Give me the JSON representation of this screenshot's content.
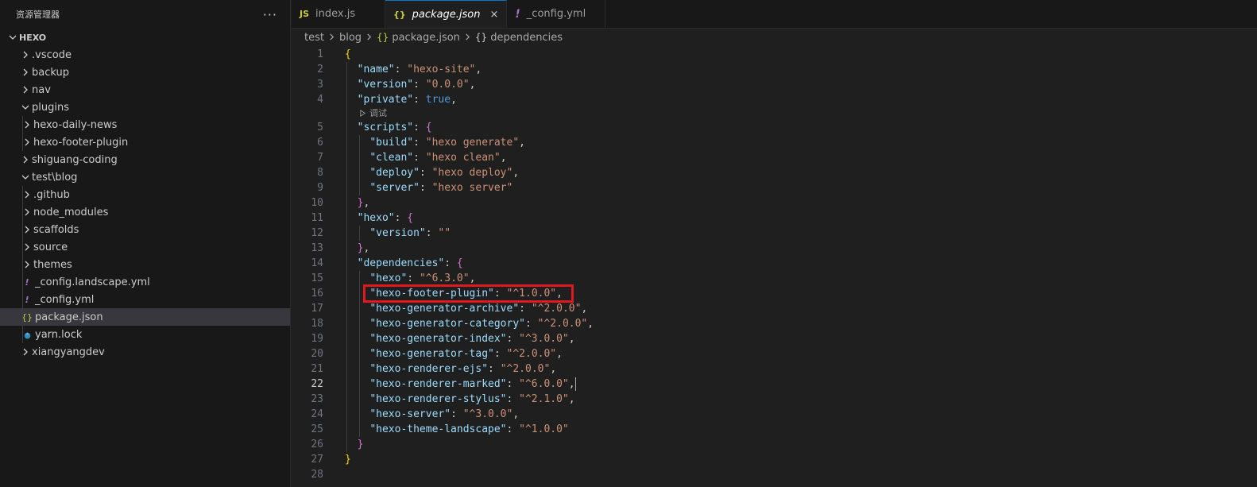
{
  "sidebar": {
    "title": "资源管理器",
    "more": "···",
    "root": "HEXO",
    "items": [
      {
        "label": ".vscode",
        "depth": 1,
        "type": "folder",
        "open": false
      },
      {
        "label": "backup",
        "depth": 1,
        "type": "folder",
        "open": false
      },
      {
        "label": "nav",
        "depth": 1,
        "type": "folder",
        "open": false
      },
      {
        "label": "plugins",
        "depth": 1,
        "type": "folder",
        "open": true
      },
      {
        "label": "hexo-daily-news",
        "depth": 2,
        "type": "folder",
        "open": false
      },
      {
        "label": "hexo-footer-plugin",
        "depth": 2,
        "type": "folder",
        "open": false
      },
      {
        "label": "shiguang-coding",
        "depth": 1,
        "type": "folder",
        "open": false
      },
      {
        "label": "test\\blog",
        "depth": 1,
        "type": "folder",
        "open": true
      },
      {
        "label": ".github",
        "depth": 2,
        "type": "folder",
        "open": false
      },
      {
        "label": "node_modules",
        "depth": 2,
        "type": "folder",
        "open": false
      },
      {
        "label": "scaffolds",
        "depth": 2,
        "type": "folder",
        "open": false
      },
      {
        "label": "source",
        "depth": 2,
        "type": "folder",
        "open": false
      },
      {
        "label": "themes",
        "depth": 2,
        "type": "folder",
        "open": false
      },
      {
        "label": "_config.landscape.yml",
        "depth": 2,
        "type": "yml"
      },
      {
        "label": "_config.yml",
        "depth": 2,
        "type": "yml"
      },
      {
        "label": "package.json",
        "depth": 2,
        "type": "json",
        "selected": true
      },
      {
        "label": "yarn.lock",
        "depth": 2,
        "type": "yarn"
      },
      {
        "label": "xiangyangdev",
        "depth": 1,
        "type": "folder",
        "open": false
      }
    ]
  },
  "tabs": [
    {
      "label": "index.js",
      "icon": "JS",
      "icon_color": "#cbcb41",
      "active": false
    },
    {
      "label": "package.json",
      "icon": "{}",
      "icon_color": "#cbcb41",
      "active": true,
      "close": "×"
    },
    {
      "label": "_config.yml",
      "icon": "!",
      "icon_color": "#a074c4",
      "active": false
    }
  ],
  "breadcrumbs": [
    "test",
    "blog",
    "package.json",
    "dependencies"
  ],
  "breadcrumb_icons": {
    "package.json": "{}",
    "dependencies": "{}"
  },
  "codelens_label": "调试",
  "current_line": 22,
  "highlight_line": 16,
  "code_lines": [
    [
      [
        "{",
        "b1"
      ]
    ],
    [
      [
        "  ",
        "p"
      ],
      [
        "\"name\"",
        "k"
      ],
      [
        ": ",
        "p"
      ],
      [
        "\"hexo-site\"",
        "s"
      ],
      [
        ",",
        "p"
      ]
    ],
    [
      [
        "  ",
        "p"
      ],
      [
        "\"version\"",
        "k"
      ],
      [
        ": ",
        "p"
      ],
      [
        "\"0.0.0\"",
        "s"
      ],
      [
        ",",
        "p"
      ]
    ],
    [
      [
        "  ",
        "p"
      ],
      [
        "\"private\"",
        "k"
      ],
      [
        ": ",
        "p"
      ],
      [
        "true",
        "kw"
      ],
      [
        ",",
        "p"
      ]
    ],
    [
      [
        "  ",
        "p"
      ],
      [
        "\"scripts\"",
        "k"
      ],
      [
        ": ",
        "p"
      ],
      [
        "{",
        "b2"
      ]
    ],
    [
      [
        "    ",
        "p"
      ],
      [
        "\"build\"",
        "k"
      ],
      [
        ": ",
        "p"
      ],
      [
        "\"hexo generate\"",
        "s"
      ],
      [
        ",",
        "p"
      ]
    ],
    [
      [
        "    ",
        "p"
      ],
      [
        "\"clean\"",
        "k"
      ],
      [
        ": ",
        "p"
      ],
      [
        "\"hexo clean\"",
        "s"
      ],
      [
        ",",
        "p"
      ]
    ],
    [
      [
        "    ",
        "p"
      ],
      [
        "\"deploy\"",
        "k"
      ],
      [
        ": ",
        "p"
      ],
      [
        "\"hexo deploy\"",
        "s"
      ],
      [
        ",",
        "p"
      ]
    ],
    [
      [
        "    ",
        "p"
      ],
      [
        "\"server\"",
        "k"
      ],
      [
        ": ",
        "p"
      ],
      [
        "\"hexo server\"",
        "s"
      ]
    ],
    [
      [
        "  ",
        "p"
      ],
      [
        "}",
        "b2"
      ],
      [
        ",",
        "p"
      ]
    ],
    [
      [
        "  ",
        "p"
      ],
      [
        "\"hexo\"",
        "k"
      ],
      [
        ": ",
        "p"
      ],
      [
        "{",
        "b2"
      ]
    ],
    [
      [
        "    ",
        "p"
      ],
      [
        "\"version\"",
        "k"
      ],
      [
        ": ",
        "p"
      ],
      [
        "\"\"",
        "s"
      ]
    ],
    [
      [
        "  ",
        "p"
      ],
      [
        "}",
        "b2"
      ],
      [
        ",",
        "p"
      ]
    ],
    [
      [
        "  ",
        "p"
      ],
      [
        "\"dependencies\"",
        "k"
      ],
      [
        ": ",
        "p"
      ],
      [
        "{",
        "b2"
      ]
    ],
    [
      [
        "    ",
        "p"
      ],
      [
        "\"hexo\"",
        "k"
      ],
      [
        ": ",
        "p"
      ],
      [
        "\"^6.3.0\"",
        "s"
      ],
      [
        ",",
        "p"
      ]
    ],
    [
      [
        "    ",
        "p"
      ],
      [
        "\"hexo-footer-plugin\"",
        "k"
      ],
      [
        ": ",
        "p"
      ],
      [
        "\"^1.0.0\"",
        "s"
      ],
      [
        ",",
        "p"
      ]
    ],
    [
      [
        "    ",
        "p"
      ],
      [
        "\"hexo-generator-archive\"",
        "k"
      ],
      [
        ": ",
        "p"
      ],
      [
        "\"^2.0.0\"",
        "s"
      ],
      [
        ",",
        "p"
      ]
    ],
    [
      [
        "    ",
        "p"
      ],
      [
        "\"hexo-generator-category\"",
        "k"
      ],
      [
        ": ",
        "p"
      ],
      [
        "\"^2.0.0\"",
        "s"
      ],
      [
        ",",
        "p"
      ]
    ],
    [
      [
        "    ",
        "p"
      ],
      [
        "\"hexo-generator-index\"",
        "k"
      ],
      [
        ": ",
        "p"
      ],
      [
        "\"^3.0.0\"",
        "s"
      ],
      [
        ",",
        "p"
      ]
    ],
    [
      [
        "    ",
        "p"
      ],
      [
        "\"hexo-generator-tag\"",
        "k"
      ],
      [
        ": ",
        "p"
      ],
      [
        "\"^2.0.0\"",
        "s"
      ],
      [
        ",",
        "p"
      ]
    ],
    [
      [
        "    ",
        "p"
      ],
      [
        "\"hexo-renderer-ejs\"",
        "k"
      ],
      [
        ": ",
        "p"
      ],
      [
        "\"^2.0.0\"",
        "s"
      ],
      [
        ",",
        "p"
      ]
    ],
    [
      [
        "    ",
        "p"
      ],
      [
        "\"hexo-renderer-marked\"",
        "k"
      ],
      [
        ": ",
        "p"
      ],
      [
        "\"^6.0.0\"",
        "s"
      ],
      [
        ",",
        "p"
      ]
    ],
    [
      [
        "    ",
        "p"
      ],
      [
        "\"hexo-renderer-stylus\"",
        "k"
      ],
      [
        ": ",
        "p"
      ],
      [
        "\"^2.1.0\"",
        "s"
      ],
      [
        ",",
        "p"
      ]
    ],
    [
      [
        "    ",
        "p"
      ],
      [
        "\"hexo-server\"",
        "k"
      ],
      [
        ": ",
        "p"
      ],
      [
        "\"^3.0.0\"",
        "s"
      ],
      [
        ",",
        "p"
      ]
    ],
    [
      [
        "    ",
        "p"
      ],
      [
        "\"hexo-theme-landscape\"",
        "k"
      ],
      [
        ": ",
        "p"
      ],
      [
        "\"^1.0.0\"",
        "s"
      ]
    ],
    [
      [
        "  ",
        "p"
      ],
      [
        "}",
        "b2"
      ]
    ],
    [
      [
        "}",
        "b1"
      ]
    ],
    []
  ]
}
